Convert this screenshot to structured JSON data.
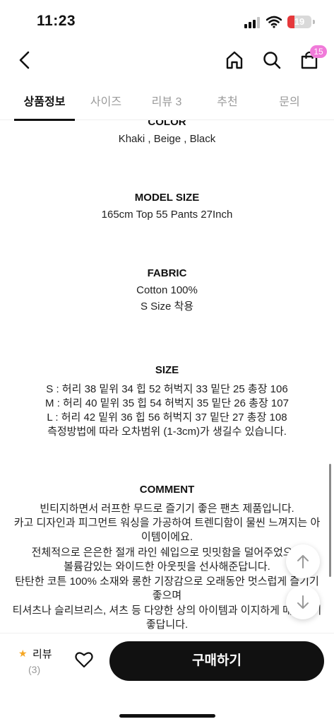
{
  "status_bar": {
    "time": "11:23",
    "battery": "19",
    "icons": [
      "cellular-signal-icon",
      "wifi-icon",
      "battery-icon"
    ]
  },
  "header": {
    "icons": [
      "back-arrow-icon",
      "home-icon",
      "search-icon",
      "shopping-bag-icon"
    ],
    "cart_count": "15"
  },
  "tabs": [
    {
      "label": "상품정보",
      "active": true
    },
    {
      "label": "사이즈",
      "active": false
    },
    {
      "label": "리뷰 3",
      "active": false
    },
    {
      "label": "추천",
      "active": false
    },
    {
      "label": "문의",
      "active": false
    }
  ],
  "content": {
    "color": {
      "title": "COLOR",
      "value": "Khaki , Beige , Black"
    },
    "model_size": {
      "title": "MODEL SIZE",
      "value": "165cm Top 55 Pants 27Inch"
    },
    "fabric": {
      "title": "FABRIC",
      "lines": [
        "Cotton 100%",
        "S Size 착용"
      ]
    },
    "size": {
      "title": "SIZE",
      "lines": [
        "S : 허리 38 밑위 34 힙 52 허벅지 33 밑단 25 총장 106",
        "M : 허리 40 밑위 35 힙 54 허벅지 35 밑단 26 총장 107",
        "L : 허리 42 밑위 36 힙 56 허벅지 37 밑단 27 총장 108",
        "측정방법에 따라 오차범위 (1-3cm)가 생길수 있습니다."
      ]
    },
    "comment": {
      "title": "COMMENT",
      "lines": [
        "빈티지하면서 러프한 무드로 즐기기 좋은 팬츠 제품입니다.",
        "카고 디자인과 피그먼트 워싱을 가공하여 트렌디함이 물씬 느껴지는 아",
        "이템이에요.",
        "전체적으로 은은한 절개 라인 쉐입으로 밋밋함을 덜어주었으며",
        "볼륨감있는 와이드한 아웃핏을 선사해준답니다.",
        "탄탄한 코튼 100% 소재와 롱한 기장감으로 오래동안 멋스럽게 즐기기",
        "좋으며",
        "티셔츠나 슬리브리스, 셔츠 등 다양한 상의 아이템과 이지하게 매치하기",
        "좋답니다."
      ]
    }
  },
  "scroll_buttons": [
    "scroll-up-icon",
    "scroll-down-icon"
  ],
  "bottom_bar": {
    "review_label": "리뷰",
    "review_count": "(3)",
    "buy_label": "구매하기"
  },
  "colors": {
    "accent_badge": "#f07ad9",
    "star": "#f5a623",
    "buy_button": "#111111",
    "battery_low": "#e5383b"
  }
}
